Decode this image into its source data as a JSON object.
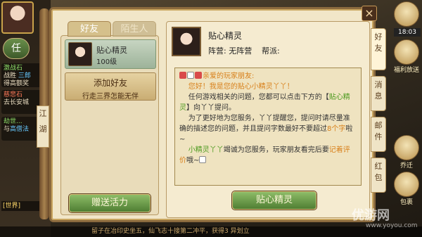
{
  "left_panel": {
    "task_button": "任",
    "quests": [
      {
        "title": "激战石",
        "line2": "战胜 ",
        "line2_hl": "三郎",
        "line3": "得高额奖"
      },
      {
        "title": "慈悲石",
        "line2": "去长安城",
        "line2_hl": "",
        "line3": ""
      },
      {
        "title": "劫世...",
        "line2": "与",
        "line2_hl": "高僧法",
        "line3": ""
      }
    ],
    "scroll_label": "江湖",
    "world_chat": "[世界]"
  },
  "bottom_chat": "留子在冶印史坐五，仙飞志十接第二冲平，获得3 异划立",
  "dialog": {
    "tabs": {
      "active": "好友",
      "inactive": "陌生人"
    },
    "friend": {
      "name": "贴心精灵",
      "level": "100级"
    },
    "add_friend": {
      "title": "添加好友",
      "subtitle": "行走三界怎能无伴"
    },
    "gift_button": "赠送活力",
    "npc": {
      "name": "贴心精灵",
      "camp": "阵营: 无阵营",
      "clan": "帮派:"
    },
    "message": {
      "greeting": "亲爱的玩家朋友:",
      "line1": "您好！我是您的贴心小精灵丫丫！",
      "line2a": "任何游戏相关的问题，您都可以点击下方的【",
      "line2b": "贴心精灵",
      "line2c": "】向丫丫提问。",
      "line3a": "为了更好地为您服务，丫丫提醒您，提问时请尽量准确的描述您的问题，并且提问字数最好不要超过",
      "line3b": "8个字",
      "line3c": "啦~",
      "line4a": "小精灵丫丫",
      "line4b": "竭诚为您服务，玩家朋友看完后要",
      "line4c": "记着评价",
      "line4d": "哦~"
    },
    "elf_button": "贴心精灵",
    "close_icon": "×"
  },
  "vertical_tabs": [
    "好友",
    "消息",
    "邮件",
    "红包"
  ],
  "right_icons": {
    "time": "18:03",
    "welfare": "福利放送",
    "fight": "乔迁",
    "bag": "包裹"
  },
  "watermark": {
    "text": "优游网",
    "url": "www.yoyou.com"
  }
}
